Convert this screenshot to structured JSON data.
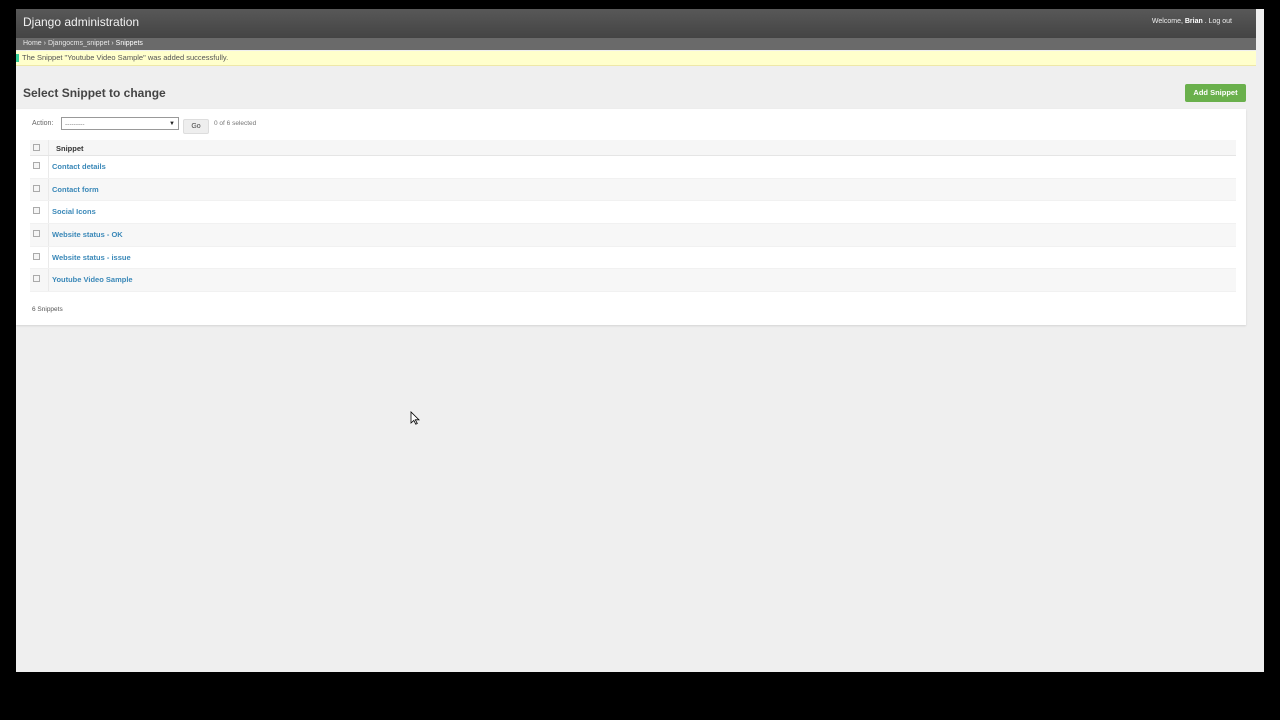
{
  "header": {
    "brand": "Django administration",
    "welcome_prefix": "Welcome,",
    "username": "Brian",
    "separator": ".",
    "logout_label": "Log out"
  },
  "breadcrumbs": {
    "items": [
      "Home",
      "Djangocms_snippet",
      "Snippets"
    ],
    "divider": "›"
  },
  "message": {
    "text": "The Snippet \"Youtube Video Sample\" was added successfully.",
    "color": "#ffffcc"
  },
  "page": {
    "title": "Select Snippet to change",
    "add_button": "Add Snippet"
  },
  "actions": {
    "label": "Action:",
    "select_value": "---------",
    "go_label": "Go",
    "selected_count": "0 of 6 selected"
  },
  "table": {
    "column_header": "Snippet",
    "rows": [
      "Contact details",
      "Contact form",
      "Social Icons",
      "Website status - OK",
      "Website status - issue",
      "Youtube Video Sample"
    ]
  },
  "paginator": "6 Snippets",
  "colors": {
    "accent_green": "#6ab04c",
    "link_blue": "#3a88b8",
    "header_dark": "#4a4a4a"
  }
}
